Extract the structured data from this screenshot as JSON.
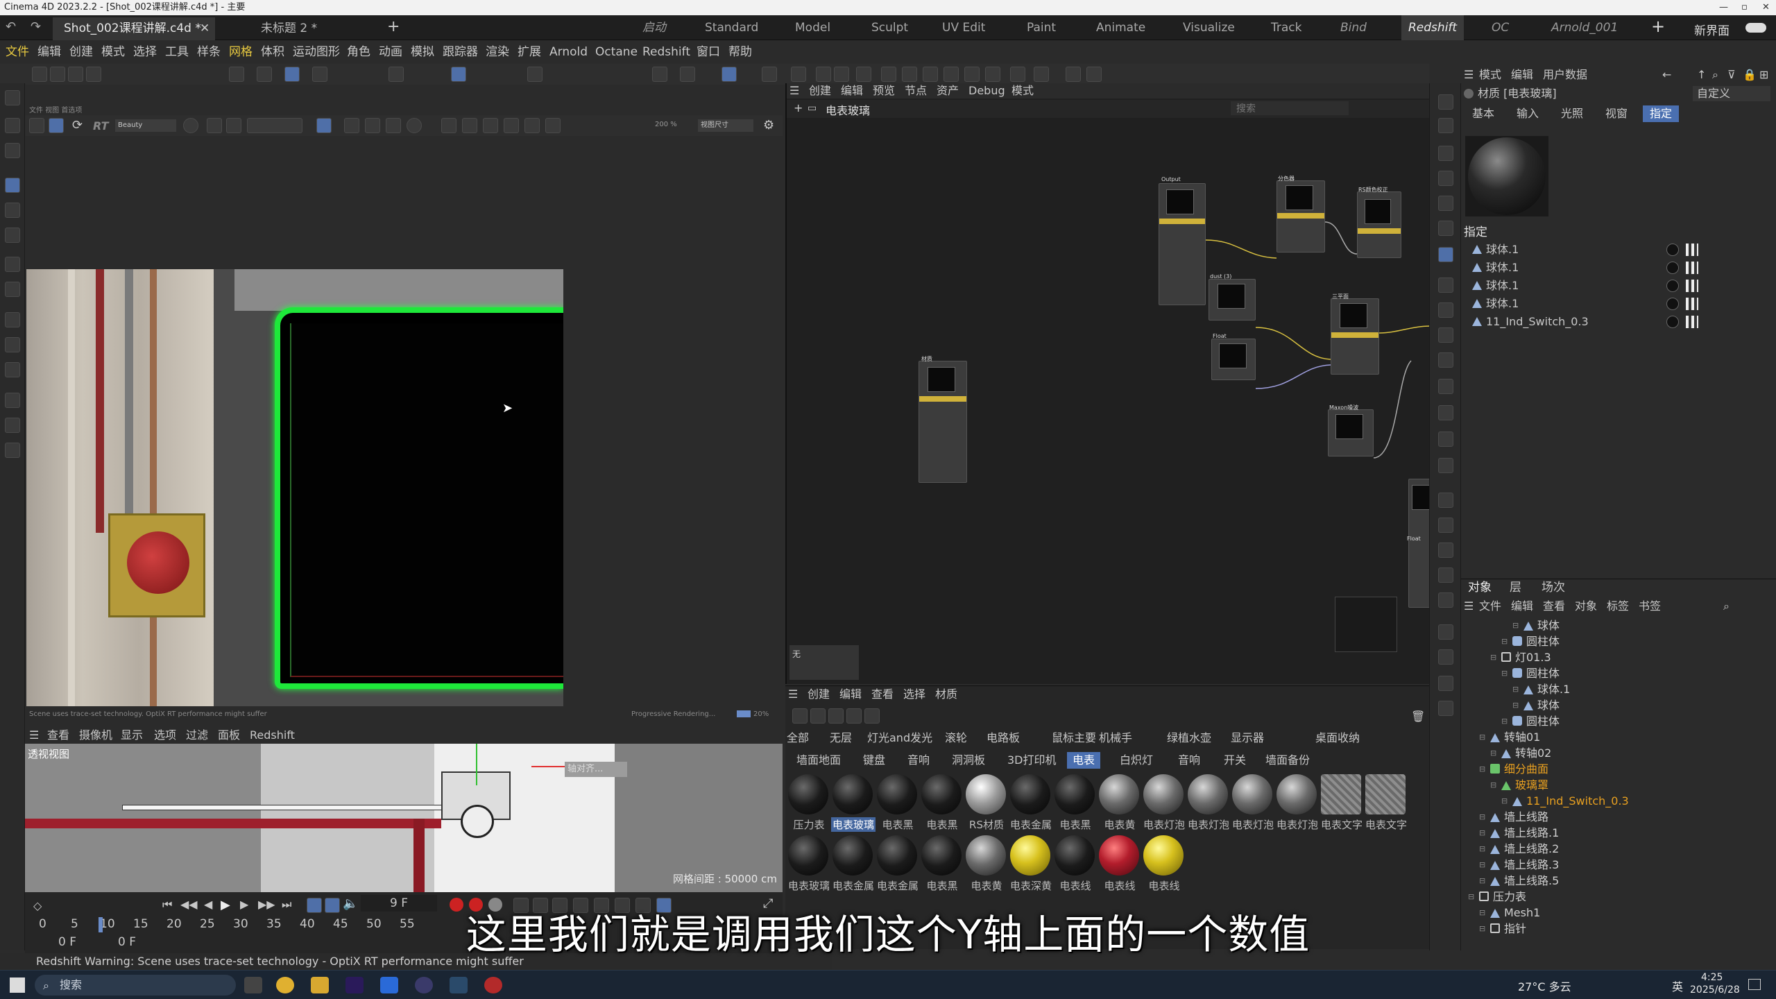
{
  "window_title": "Cinema 4D 2023.2.2 - [Shot_002课程讲解.c4d *] - 主要",
  "doc_tabs": [
    {
      "label": "Shot_002课程讲解.c4d *",
      "active": true
    },
    {
      "label": "未标题 2 *",
      "active": false
    }
  ],
  "layout_tabs": [
    "启动",
    "Standard",
    "Model",
    "Sculpt",
    "UV Edit",
    "Paint",
    "Animate",
    "Visualize",
    "Track",
    "Bind",
    "Redshift",
    "OC",
    "Arnold_001"
  ],
  "active_layout": "Redshift",
  "new_interface_label": "新界面",
  "menu": [
    "文件",
    "编辑",
    "创建",
    "模式",
    "选择",
    "工具",
    "样条",
    "网格",
    "体积",
    "运动图形",
    "角色",
    "动画",
    "模拟",
    "跟踪器",
    "渲染",
    "扩展",
    "Arnold",
    "Octane",
    "Redshift",
    "窗口",
    "帮助"
  ],
  "render_view": {
    "menu": [
      "文件",
      "视图",
      "首选项"
    ],
    "rt_label": "RT",
    "aov": "Beauty",
    "zoom": "200 %",
    "fit": "视图尺寸",
    "status_left": "Scene uses trace-set technology. OptiX RT performance might suffer",
    "status_right": "Progressive Rendering...",
    "progress_label": "20%"
  },
  "perspective": {
    "menu": [
      "查看",
      "摄像机",
      "显示",
      "选项",
      "过滤",
      "面板",
      "Redshift"
    ],
    "view_name": "透视视图",
    "axis_label": "轴对齐...",
    "grid_label": "网格间距 : 50000 cm"
  },
  "timeline": {
    "frame_field": "9 F",
    "ticks": [
      "0",
      "5",
      "10",
      "15",
      "20",
      "25",
      "30",
      "35",
      "40",
      "45",
      "50",
      "55"
    ],
    "start": "0 F",
    "current": "0 F"
  },
  "node_editor": {
    "menu": [
      "创建",
      "编辑",
      "预览",
      "节点",
      "资产",
      "Debug",
      "模式"
    ],
    "breadcrumb": "电表玻璃",
    "search_placeholder": "搜索",
    "node_titles": [
      "Output",
      "材质",
      "分色器",
      "RS颜色校正",
      "dust (3)",
      "Float",
      "三平面",
      "Maxon噪波",
      "Float"
    ],
    "mini_label": "无"
  },
  "material_manager": {
    "menu": [
      "创建",
      "编辑",
      "查看",
      "选择",
      "材质"
    ],
    "tabs_row1": [
      "全部",
      "无层",
      "灯光and发光",
      "滚轮",
      "电路板",
      "鼠标主要",
      "机械手",
      "绿植水壶",
      "显示器",
      "桌面收纳"
    ],
    "tabs_row2": [
      "墙面地面",
      "键盘",
      "音响",
      "洞洞板",
      "3D打印机",
      "电表",
      "白炽灯",
      "音响",
      "开关",
      "墙面备份"
    ],
    "active_tab": "电表",
    "row1": [
      {
        "label": "压力表",
        "ball": "black"
      },
      {
        "label": "电表玻璃",
        "ball": "black",
        "selected": true
      },
      {
        "label": "电表黑",
        "ball": "black"
      },
      {
        "label": "电表黑",
        "ball": "black"
      },
      {
        "label": "RS材质",
        "ball": "grey"
      },
      {
        "label": "电表金属",
        "ball": "black"
      },
      {
        "label": "电表黑",
        "ball": "black"
      },
      {
        "label": "电表黄",
        "ball": "silver"
      },
      {
        "label": "电表灯泡",
        "ball": "silver"
      },
      {
        "label": "电表灯泡",
        "ball": "silver"
      },
      {
        "label": "电表灯泡",
        "ball": "silver"
      },
      {
        "label": "电表灯泡",
        "ball": "silver"
      },
      {
        "label": "电表文字",
        "ball": "tex"
      },
      {
        "label": "电表文字",
        "ball": "tex"
      }
    ],
    "row2": [
      {
        "label": "电表玻璃",
        "ball": "black"
      },
      {
        "label": "电表金属",
        "ball": "black"
      },
      {
        "label": "电表金属",
        "ball": "black"
      },
      {
        "label": "电表黑",
        "ball": "black"
      },
      {
        "label": "电表黄",
        "ball": "silver"
      },
      {
        "label": "电表深黄",
        "ball": "gold"
      },
      {
        "label": "电表线",
        "ball": "black"
      },
      {
        "label": "电表线",
        "ball": "red"
      },
      {
        "label": "电表线",
        "ball": "gold"
      }
    ]
  },
  "attributes": {
    "menu": [
      "模式",
      "编辑",
      "用户数据"
    ],
    "title": "材质 [电表玻璃]",
    "preset": "自定义",
    "tabs": [
      "基本",
      "输入",
      "光照",
      "视窗",
      "指定"
    ],
    "active_tab": "指定",
    "section": "指定",
    "assign_list": [
      "球体.1",
      "球体.1",
      "球体.1",
      "球体.1",
      "11_Ind_Switch_0.3"
    ]
  },
  "object_manager": {
    "tabs": [
      "对象",
      "层",
      "场次"
    ],
    "menu": [
      "文件",
      "编辑",
      "查看",
      "对象",
      "标签",
      "书签"
    ],
    "rows": [
      {
        "indent": 4,
        "label": "球体",
        "kind": "tri"
      },
      {
        "indent": 3,
        "label": "圆柱体",
        "kind": "cyl"
      },
      {
        "indent": 2,
        "label": "灯01.3",
        "kind": "null"
      },
      {
        "indent": 3,
        "label": "圆柱体",
        "kind": "cyl"
      },
      {
        "indent": 4,
        "label": "球体.1",
        "kind": "tri"
      },
      {
        "indent": 4,
        "label": "球体",
        "kind": "tri"
      },
      {
        "indent": 3,
        "label": "圆柱体",
        "kind": "cyl"
      },
      {
        "indent": 1,
        "label": "转轴01",
        "kind": "tri"
      },
      {
        "indent": 2,
        "label": "转轴02",
        "kind": "tri"
      },
      {
        "indent": 1,
        "label": "细分曲面",
        "kind": "sub",
        "color": "#e8a020"
      },
      {
        "indent": 2,
        "label": "玻璃罩",
        "kind": "green",
        "color": "#e8a020"
      },
      {
        "indent": 3,
        "label": "11_Ind_Switch_0.3",
        "kind": "tri",
        "color": "#e8a020"
      },
      {
        "indent": 1,
        "label": "墙上线路",
        "kind": "tri"
      },
      {
        "indent": 1,
        "label": "墙上线路.1",
        "kind": "tri"
      },
      {
        "indent": 1,
        "label": "墙上线路.2",
        "kind": "tri"
      },
      {
        "indent": 1,
        "label": "墙上线路.3",
        "kind": "tri"
      },
      {
        "indent": 1,
        "label": "墙上线路.5",
        "kind": "tri"
      },
      {
        "indent": 0,
        "label": "压力表",
        "kind": "null"
      },
      {
        "indent": 1,
        "label": "Mesh1",
        "kind": "tri"
      },
      {
        "indent": 1,
        "label": "指针",
        "kind": "null"
      }
    ]
  },
  "warning": "Redshift Warning: Scene uses trace-set technology - OptiX RT performance might suffer",
  "subtitle": "这里我们就是调用我们这个Y轴上面的一个数值",
  "taskbar": {
    "search_placeholder": "搜索",
    "weather": "27°C 多云",
    "ime": "英",
    "time": "4:25",
    "date": "2025/6/28"
  },
  "colors": {
    "accent": "#4a6fb0",
    "highlight_green": "#1ee83a",
    "node_header": "#d0b23a"
  }
}
